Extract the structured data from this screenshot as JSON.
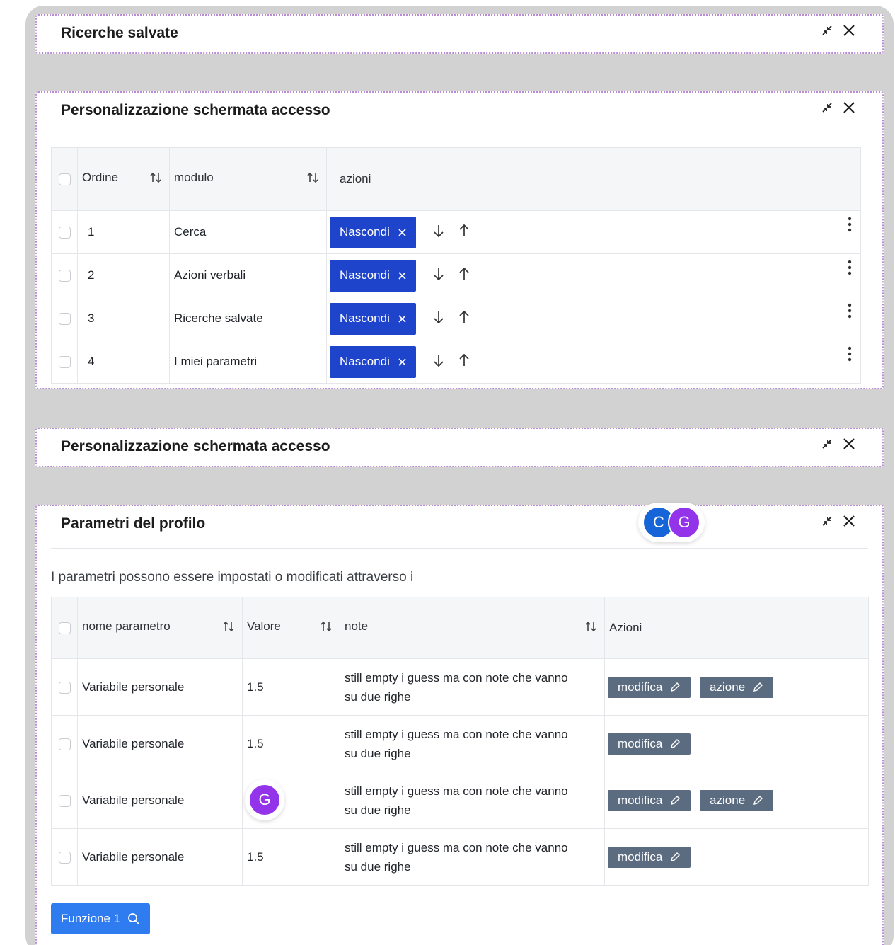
{
  "panels": {
    "saved": {
      "title": "Ricerche salvate"
    },
    "login1": {
      "title": "Personalizzazione schermata accesso"
    },
    "login2": {
      "title": "Personalizzazione schermata accesso"
    },
    "profile": {
      "title": "Parametri del profilo"
    }
  },
  "modules_table": {
    "headers": {
      "order": "Ordine",
      "module": "modulo",
      "actions": "azioni"
    },
    "hide_label": "Nascondi",
    "rows": [
      {
        "order": "1",
        "module": "Cerca"
      },
      {
        "order": "2",
        "module": "Azioni verbali"
      },
      {
        "order": "3",
        "module": "Ricerche salvate"
      },
      {
        "order": "4",
        "module": "I miei parametri"
      }
    ]
  },
  "profile_section": {
    "description": "I parametri possono essere impostati o modificati attraverso i",
    "avatars": {
      "c": "C",
      "g": "G",
      "g2": "G"
    },
    "colors": {
      "avatar_c": "#1565d8",
      "avatar_g": "#9333ea",
      "primary": "#1f44cc",
      "secondary": "#5b6b80",
      "function": "#2f7bf0"
    },
    "table": {
      "headers": {
        "name": "nome parametro",
        "value": "Valore",
        "note": "note",
        "actions": "Azioni"
      },
      "edit_label": "modifica",
      "action_label": "azione",
      "rows": [
        {
          "name": "Variabile personale",
          "value": "1.5",
          "note_line1": "still empty i guess ma con note che vanno",
          "note_line2": "su due righe"
        },
        {
          "name": "Variabile personale",
          "value": "1.5",
          "note_line1": "still empty i guess ma con note che vanno",
          "note_line2": "su due righe"
        },
        {
          "name": "Variabile personale",
          "value": "",
          "note_line1": "still empty i guess ma con note che vanno",
          "note_line2": "su due righe"
        },
        {
          "name": "Variabile personale",
          "value": "1.5",
          "note_line1": "still empty i guess ma con note che vanno",
          "note_line2": "su due righe"
        }
      ]
    },
    "function_button": "Funzione 1"
  }
}
